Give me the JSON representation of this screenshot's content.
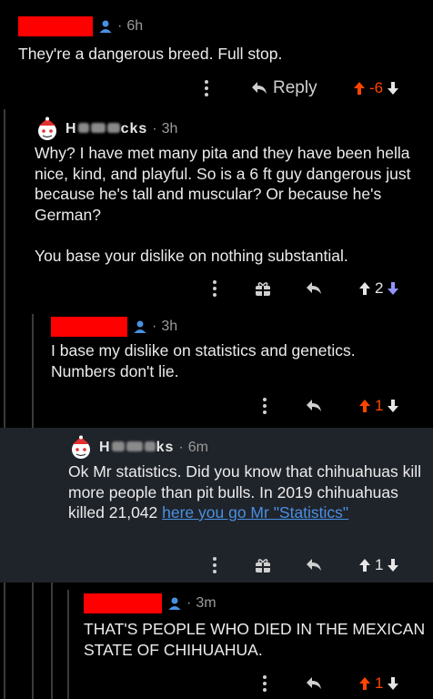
{
  "comments": [
    {
      "time": "6h",
      "text": "They're a dangerous breed. Full stop.",
      "reply_label": "Reply",
      "score": "-6"
    },
    {
      "user_tail": "cks",
      "time": "3h",
      "text": "Why? I have met many pita and they have been hella nice, kind, and playful. So is a 6 ft guy dangerous just because he's tall and muscular? Or because he's German?\n\nYou base your dislike on nothing substantial.",
      "score": "2"
    },
    {
      "time": "3h",
      "text": "I base my dislike on statistics and genetics. Numbers don't lie.",
      "score": "1"
    },
    {
      "user_tail": "ks",
      "time": "6m",
      "text": "Ok Mr statistics. Did you know that chihuahuas kill more people than pit bulls. In 2019 chihuahuas killed 21,042 ",
      "link_text": "here you go Mr \"Statistics\"",
      "score": "1"
    },
    {
      "time": "3m",
      "text": "THAT'S PEOPLE WHO DIED IN THE MEXICAN STATE OF CHIHUAHUA.",
      "score": "1"
    }
  ],
  "colors": {
    "background": "#000000",
    "highlight_bg": "#1f232a",
    "upvote_active": "#ff4500",
    "upvote_neutral": "#e6e6e6",
    "downvote": "#9494ff",
    "link": "#4a90e2",
    "redaction": "#ff0000"
  }
}
